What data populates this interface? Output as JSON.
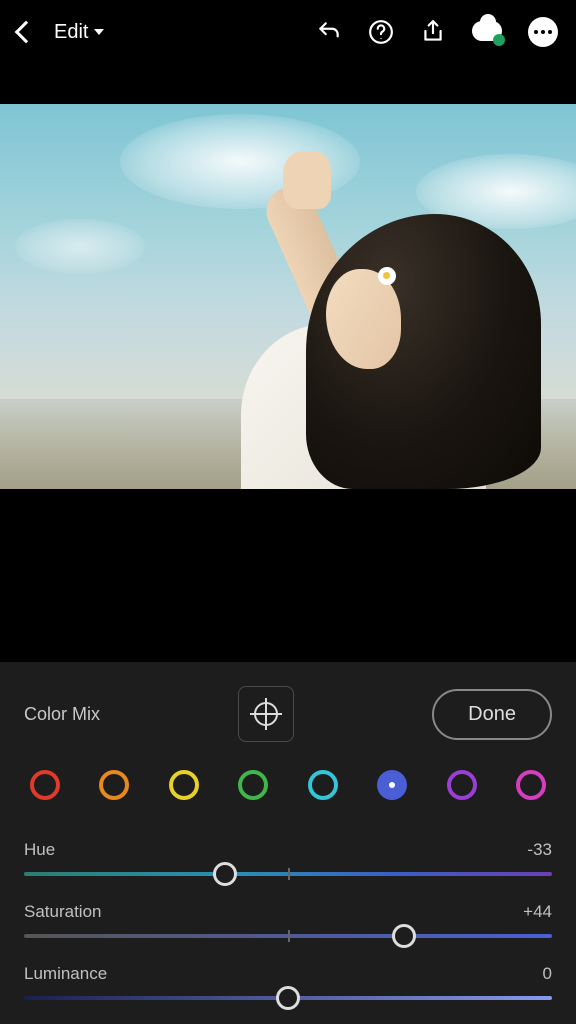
{
  "header": {
    "title": "Edit"
  },
  "panel": {
    "title": "Color Mix",
    "done_label": "Done"
  },
  "swatches": [
    {
      "name": "red",
      "color": "#e03a2a",
      "selected": false
    },
    {
      "name": "orange",
      "color": "#e8891f",
      "selected": false
    },
    {
      "name": "yellow",
      "color": "#e8d028",
      "selected": false
    },
    {
      "name": "green",
      "color": "#3fb54a",
      "selected": false
    },
    {
      "name": "aqua",
      "color": "#35c5d8",
      "selected": false
    },
    {
      "name": "blue",
      "color": "#4a5fd5",
      "selected": true
    },
    {
      "name": "purple",
      "color": "#9a3fd5",
      "selected": false
    },
    {
      "name": "magenta",
      "color": "#d53fbf",
      "selected": false
    }
  ],
  "sliders": {
    "hue": {
      "label": "Hue",
      "value": "-33",
      "position": 38
    },
    "saturation": {
      "label": "Saturation",
      "value": "+44",
      "position": 72
    },
    "luminance": {
      "label": "Luminance",
      "value": "0",
      "position": 50
    }
  }
}
